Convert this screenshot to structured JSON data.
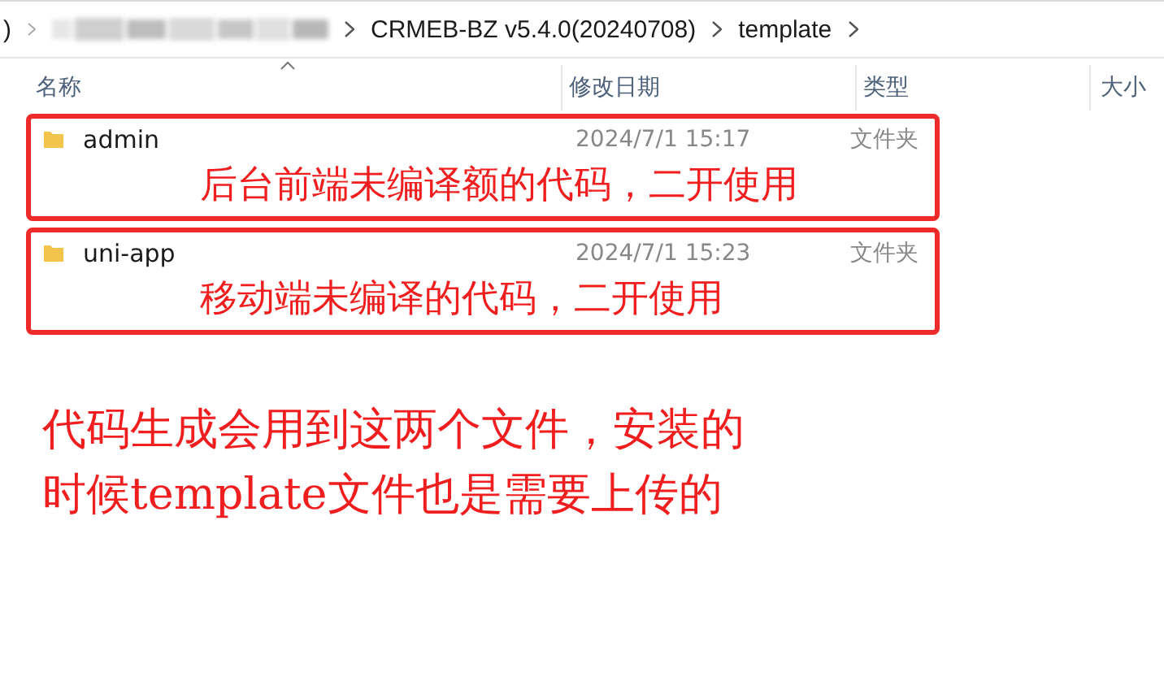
{
  "breadcrumb": {
    "lead": ")",
    "items": [
      "CRMEB-BZ v5.4.0(20240708)",
      "template"
    ]
  },
  "columns": [
    {
      "label": "名称",
      "sorted": true
    },
    {
      "label": "修改日期",
      "sorted": false
    },
    {
      "label": "类型",
      "sorted": false
    },
    {
      "label": "大小",
      "sorted": false
    }
  ],
  "rows": [
    {
      "name": "admin",
      "date": "2024/7/1 15:17",
      "type": "文件夹"
    },
    {
      "name": "uni-app",
      "date": "2024/7/1 15:23",
      "type": "文件夹"
    }
  ],
  "annotations": [
    "后台前端未编译额的代码，二开使用",
    "移动端未编译的代码，二开使用"
  ],
  "note": [
    "代码生成会用到这两个文件，安装的",
    "时候template文件也是需要上传的"
  ]
}
